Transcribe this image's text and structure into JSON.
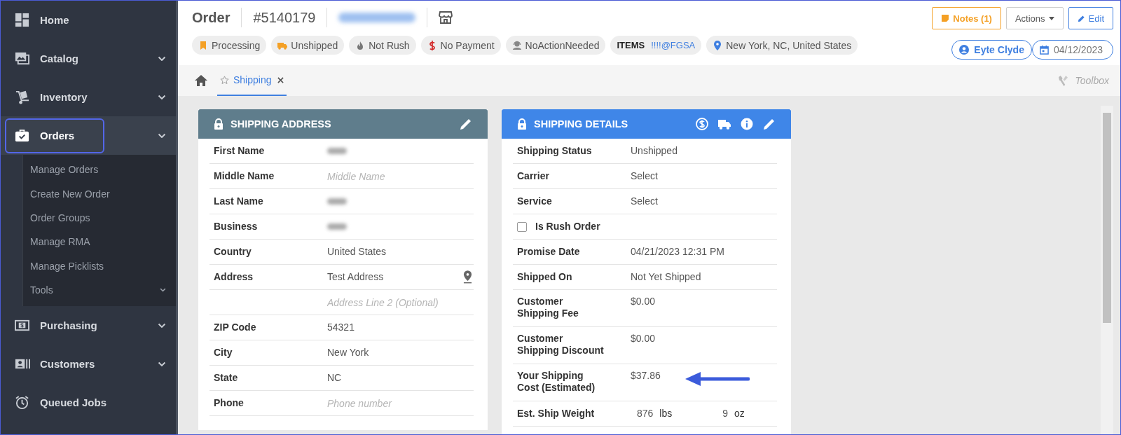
{
  "sidebar": {
    "items": [
      {
        "label": "Home",
        "expandable": false,
        "selected": false
      },
      {
        "label": "Catalog",
        "expandable": true,
        "selected": false
      },
      {
        "label": "Inventory",
        "expandable": true,
        "selected": false
      },
      {
        "label": "Orders",
        "expandable": true,
        "selected": true,
        "expanded": true,
        "children": [
          {
            "label": "Manage Orders",
            "expandable": false
          },
          {
            "label": "Create New Order",
            "expandable": false
          },
          {
            "label": "Order Groups",
            "expandable": false
          },
          {
            "label": "Manage RMA",
            "expandable": false
          },
          {
            "label": "Manage Picklists",
            "expandable": false
          },
          {
            "label": "Tools",
            "expandable": true
          }
        ]
      },
      {
        "label": "Purchasing",
        "expandable": true,
        "selected": false
      },
      {
        "label": "Customers",
        "expandable": true,
        "selected": false
      },
      {
        "label": "Queued Jobs",
        "expandable": false,
        "selected": false
      }
    ]
  },
  "header": {
    "title": "Order",
    "order_number": "#5140179",
    "chips": [
      {
        "kind": "bookmark",
        "label": "Processing"
      },
      {
        "kind": "truck",
        "label": "Unshipped"
      },
      {
        "kind": "flame",
        "label": "Not Rush"
      },
      {
        "kind": "dollar",
        "label": "No Payment"
      },
      {
        "kind": "person",
        "label": "NoActionNeeded"
      },
      {
        "kind": "items",
        "label": "ITEMS",
        "value": "!!!!@FGSA"
      },
      {
        "kind": "pin",
        "label": "New York, NC, United States"
      }
    ],
    "buttons": [
      {
        "kind": "notes",
        "label": "Notes (1)"
      },
      {
        "kind": "actions",
        "label": "Actions"
      },
      {
        "kind": "edit",
        "label": "Edit"
      }
    ],
    "assignee": "Eyte Clyde",
    "date": "04/12/2023"
  },
  "tabs": [
    {
      "label": "Shipping",
      "selected": true
    }
  ],
  "toolbox": "Toolbox",
  "address_card": {
    "title": "SHIPPING ADDRESS",
    "rows": [
      {
        "label": "First Name",
        "kind": "redacted"
      },
      {
        "label": "Middle Name",
        "kind": "input",
        "placeholder": "Middle Name"
      },
      {
        "label": "Last Name",
        "kind": "redacted"
      },
      {
        "label": "Business",
        "kind": "redacted"
      },
      {
        "label": "Country",
        "kind": "text",
        "value": "United States"
      },
      {
        "label": "Address",
        "kind": "address",
        "value": "Test Address"
      },
      {
        "kind": "input",
        "placeholder": "Address Line 2 (Optional)"
      },
      {
        "label": "ZIP Code",
        "kind": "text",
        "value": "54321"
      },
      {
        "label": "City",
        "kind": "text",
        "value": "New York"
      },
      {
        "label": "State",
        "kind": "text",
        "value": "NC"
      },
      {
        "label": "Phone",
        "kind": "input",
        "placeholder": "Phone number"
      }
    ]
  },
  "details_card": {
    "title": "SHIPPING DETAILS",
    "rows": [
      {
        "label": "Shipping Status",
        "kind": "text",
        "value": "Unshipped"
      },
      {
        "label": "Carrier",
        "kind": "select",
        "value": "Select"
      },
      {
        "label": "Service",
        "kind": "select",
        "value": "Select"
      },
      {
        "label": "Is Rush Order",
        "kind": "checkbox",
        "checked": false
      },
      {
        "label": "Promise Date",
        "kind": "text",
        "value": "04/21/2023 12:31 PM"
      },
      {
        "label": "Shipped On",
        "kind": "text",
        "value": "Not Yet Shipped"
      },
      {
        "label": "Customer Shipping Fee",
        "kind": "text",
        "value": "$0.00"
      },
      {
        "label": "Customer Shipping Discount",
        "kind": "text",
        "value": "$0.00"
      },
      {
        "label": "Your Shipping Cost (Estimated)",
        "kind": "text",
        "value": "$37.86",
        "arrow": true
      },
      {
        "label": "Est. Ship Weight",
        "kind": "weight",
        "lbs": "876",
        "lbs_unit": "lbs",
        "oz": "9",
        "oz_unit": "oz"
      }
    ]
  }
}
